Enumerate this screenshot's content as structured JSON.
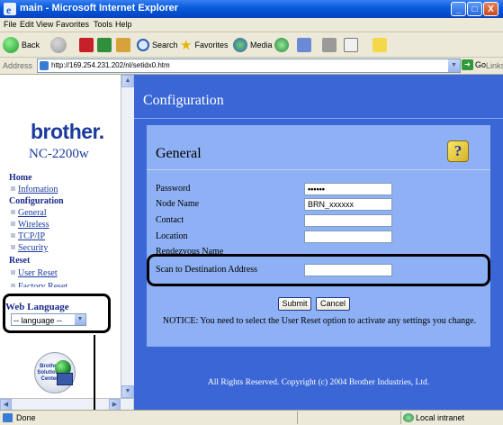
{
  "window": {
    "title": "main - Microsoft Internet Explorer",
    "controls": [
      "_",
      "□",
      "X"
    ]
  },
  "menu": [
    "File",
    "Edit",
    "View",
    "Favorites",
    "Tools",
    "Help"
  ],
  "toolbar": {
    "back": "Back",
    "search": "Search",
    "favorites": "Favorites",
    "media": "Media"
  },
  "address": {
    "label": "Address",
    "url": "http://169.254.231.202/nl/setidx0.htm",
    "go": "Go",
    "links": "Links"
  },
  "sidebar": {
    "logo": "brother.",
    "model": "NC-2200w",
    "sections": [
      {
        "heading": "Home",
        "links": [
          "Infomation"
        ]
      },
      {
        "heading": "Configuration",
        "links": [
          "General",
          "Wireless",
          "TCP/IP",
          "Security"
        ]
      },
      {
        "heading": "Reset",
        "links": [
          "User Reset",
          "Factory Reset"
        ]
      }
    ],
    "web_language_label": "Web Language",
    "language_select": "-- language --",
    "bsc_badge": "Brother Solutions Center"
  },
  "main": {
    "title": "Configuration",
    "panel_title": "General",
    "help_icon": "?",
    "fields": [
      {
        "label": "Password",
        "value": "••••••"
      },
      {
        "label": "Node Name",
        "value": "BRN_xxxxxx"
      },
      {
        "label": "Contact",
        "value": ""
      },
      {
        "label": "Location",
        "value": ""
      },
      {
        "label": "Rendezvous Name",
        "value": ""
      },
      {
        "label": "Scan to Destination Address",
        "value": ""
      }
    ],
    "submit": "Submit",
    "cancel": "Cancel",
    "notice": "NOTICE: You need to select the User Reset option to activate any settings you change.",
    "copyright": "All Rights Reserved. Copyright (c) 2004 Brother Industries, Ltd."
  },
  "status": {
    "text": "Done",
    "zone": "Local intranet"
  },
  "colors": {
    "page_bg": "#3a66d6",
    "panel_bg": "#8eb0f4",
    "link": "#1a3aa0"
  }
}
